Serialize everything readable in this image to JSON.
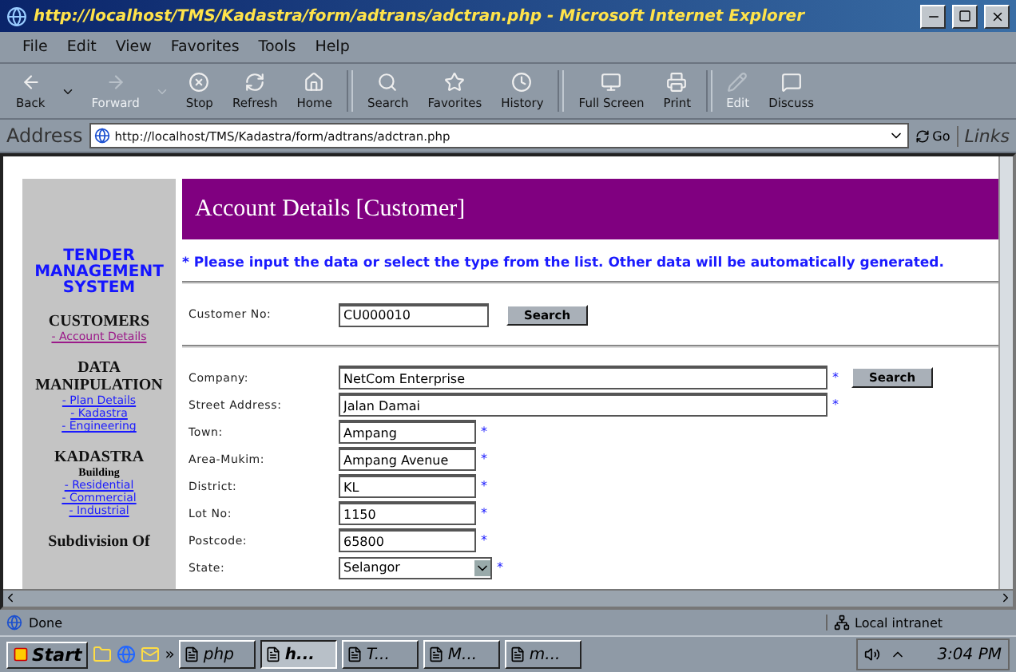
{
  "window": {
    "title": "http://localhost/TMS/Kadastra/form/adtrans/adctran.php - Microsoft Internet Explorer"
  },
  "menu": [
    "File",
    "Edit",
    "View",
    "Favorites",
    "Tools",
    "Help"
  ],
  "toolbar": [
    {
      "label": "Back",
      "disabled": false
    },
    {
      "label": "Forward",
      "disabled": true
    },
    {
      "label": "Stop",
      "disabled": false
    },
    {
      "label": "Refresh",
      "disabled": false
    },
    {
      "label": "Home",
      "disabled": false
    },
    {
      "label": "Search",
      "disabled": false
    },
    {
      "label": "Favorites",
      "disabled": false
    },
    {
      "label": "History",
      "disabled": false
    },
    {
      "label": "Full Screen",
      "disabled": false
    },
    {
      "label": "Print",
      "disabled": false
    },
    {
      "label": "Edit",
      "disabled": true
    },
    {
      "label": "Discuss",
      "disabled": false
    }
  ],
  "address": {
    "label": "Address",
    "url": "http://localhost/TMS/Kadastra/form/adtrans/adctran.php",
    "go": "Go",
    "links": "Links"
  },
  "sidebar": {
    "logo": "TENDER MANAGEMENT SYSTEM",
    "sections": [
      {
        "title": "CUSTOMERS",
        "links": [
          "- Account Details"
        ],
        "visited": true
      },
      {
        "title": "DATA MANIPULATION",
        "links": [
          "- Plan Details",
          "- Kadastra",
          "- Engineering"
        ],
        "visited": false
      },
      {
        "title": "KADASTRA",
        "subtitle": "Building",
        "links": [
          "- Residential",
          "- Commercial",
          "- Industrial"
        ],
        "visited": false
      },
      {
        "title": "Subdivision Of"
      }
    ]
  },
  "header": "Account Details [Customer]",
  "notice": "* Please input the data or select the type from the list. Other data will be automatically generated.",
  "lookup": {
    "label": "Customer No:",
    "value": "CU000010",
    "button": "Search"
  },
  "fields": [
    {
      "label": "Company:",
      "value": "NetCom Enterprise",
      "kind": "long",
      "mark": "*",
      "button": "Search"
    },
    {
      "label": "Street Address:",
      "value": "Jalan Damai",
      "kind": "long",
      "mark": "*"
    },
    {
      "label": "Town:",
      "value": "Ampang",
      "kind": "short",
      "mark": "*"
    },
    {
      "label": "Area-Mukim:",
      "value": "Ampang Avenue",
      "kind": "short",
      "mark": "*"
    },
    {
      "label": "District:",
      "value": "KL",
      "kind": "short",
      "mark": "*"
    },
    {
      "label": "Lot No:",
      "value": "1150",
      "kind": "short",
      "mark": "*"
    },
    {
      "label": "Postcode:",
      "value": "65800",
      "kind": "short",
      "mark": "*"
    },
    {
      "label": "State:",
      "value": "Selangor",
      "kind": "select",
      "mark": "*"
    }
  ],
  "status_bar": {
    "text": "Done",
    "zone": "Local intranet"
  },
  "taskbar": {
    "start": "Start",
    "more": "»",
    "tasks": [
      {
        "label": "php",
        "selected": false
      },
      {
        "label": "h...",
        "selected": true
      },
      {
        "label": "T...",
        "selected": false
      },
      {
        "label": "M...",
        "selected": false
      },
      {
        "label": "m...",
        "selected": false
      }
    ],
    "clock": "3:04 PM"
  }
}
